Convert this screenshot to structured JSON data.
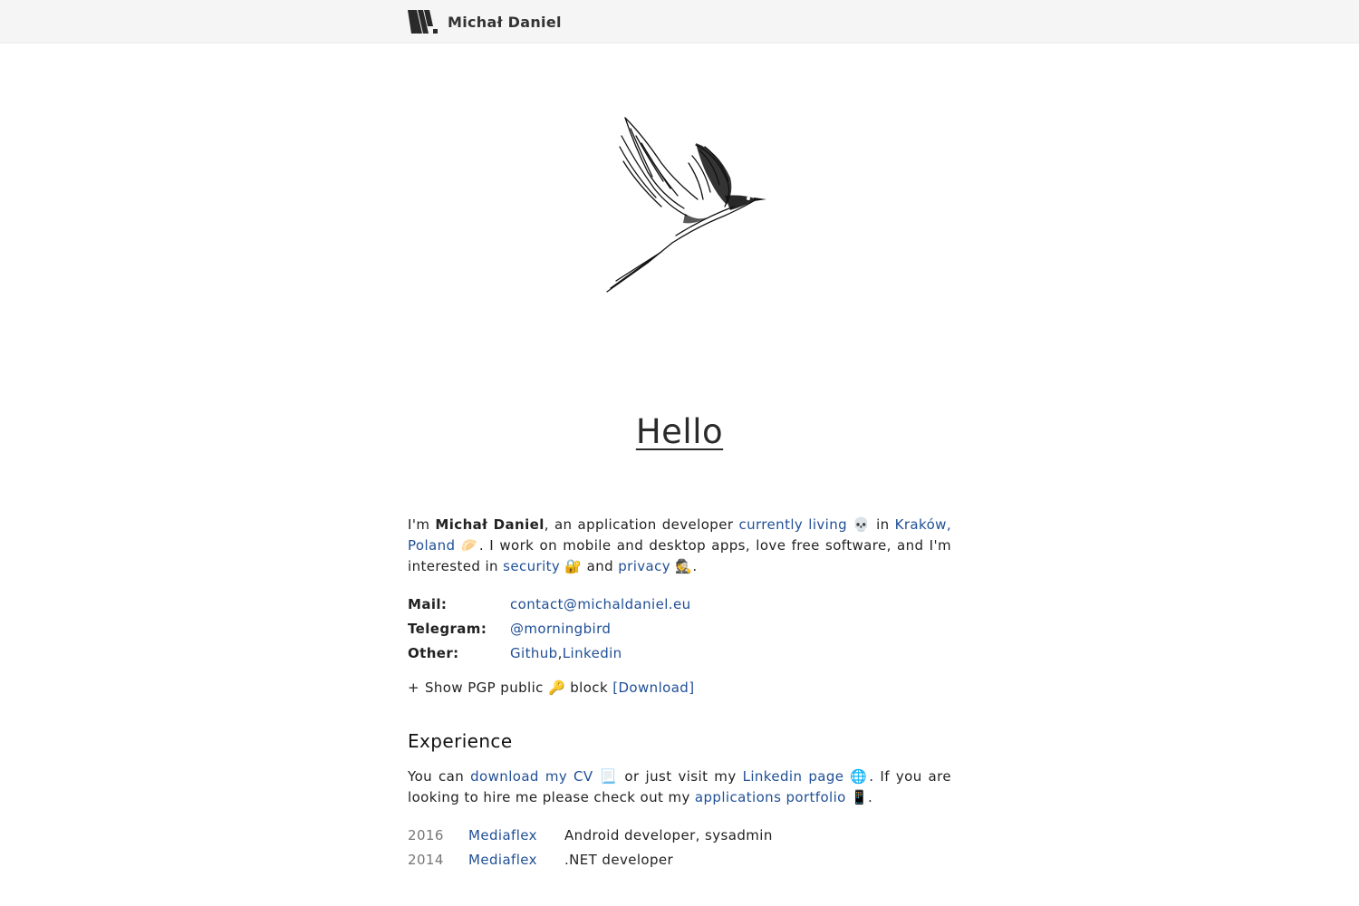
{
  "header": {
    "brand_name": "Michał Daniel",
    "logo_icon": "md-logo-icon"
  },
  "hero": {
    "image": "swallow-bird-illustration"
  },
  "title": "Hello",
  "intro": {
    "p1": "I'm ",
    "name": "Michał Daniel",
    "p2": ", an application developer ",
    "link_living": "currently living",
    "emoji_living": "💀",
    "p3": " in ",
    "link_location": "Kraków, Poland",
    "emoji_location": "🥟",
    "p4": ". I work on mobile and desktop apps, love free software, and I'm interested in ",
    "link_security": "security",
    "emoji_security": "🔐",
    "p5": " and ",
    "link_privacy": "privacy",
    "emoji_privacy": "🕵",
    "p6": "."
  },
  "contact": {
    "mail_label": "Mail:",
    "mail_value": "contact@michaldaniel.eu",
    "telegram_label": "Telegram:",
    "telegram_value": "@morningbird",
    "other_label": "Other:",
    "other_github": "Github",
    "other_sep": ", ",
    "other_linkedin": "Linkedin"
  },
  "pgp": {
    "toggle": "+",
    "text_before": "Show PGP public ",
    "emoji_key": "🔑",
    "text_after": " block ",
    "download": "[Download]"
  },
  "experience": {
    "title": "Experience",
    "p1": "You can ",
    "link_cv": "download my CV",
    "emoji_cv": "📃",
    "p2": " or just visit my ",
    "link_linkedin": "Linkedin page",
    "emoji_globe": "🌐",
    "p3": ". If you are looking to hire me please check out my ",
    "link_portfolio": "applications portfolio",
    "emoji_phone": "📱",
    "p4": ".",
    "jobs": [
      {
        "year": "2016",
        "company": "Mediaflex",
        "role": "Android developer, sysadmin"
      },
      {
        "year": "2014",
        "company": "Mediaflex",
        "role": ".NET developer"
      }
    ]
  }
}
